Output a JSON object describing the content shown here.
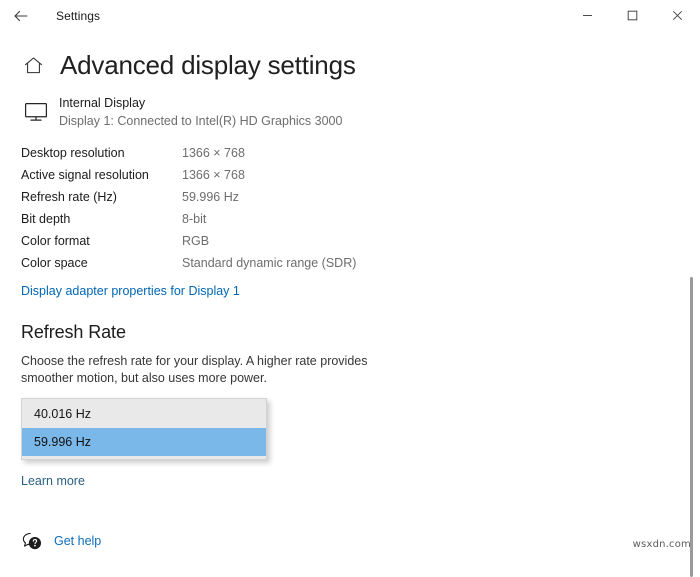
{
  "titlebar": {
    "back_icon": "back-arrow-icon",
    "title": "Settings",
    "minimize_icon": "minimize-icon",
    "maximize_icon": "maximize-icon",
    "close_icon": "close-icon"
  },
  "header": {
    "home_icon": "home-icon",
    "title": "Advanced display settings"
  },
  "display": {
    "monitor_icon": "monitor-icon",
    "name": "Internal Display",
    "subtitle": "Display 1: Connected to Intel(R) HD Graphics 3000"
  },
  "specs": [
    {
      "label": "Desktop resolution",
      "value": "1366 × 768"
    },
    {
      "label": "Active signal resolution",
      "value": "1366 × 768"
    },
    {
      "label": "Refresh rate (Hz)",
      "value": "59.996 Hz"
    },
    {
      "label": "Bit depth",
      "value": "8-bit"
    },
    {
      "label": "Color format",
      "value": "RGB"
    },
    {
      "label": "Color space",
      "value": "Standard dynamic range (SDR)"
    }
  ],
  "adapter_link": "Display adapter properties for Display 1",
  "refresh_rate": {
    "section_title": "Refresh Rate",
    "description": "Choose the refresh rate for your display. A higher rate provides smoother motion, but also uses more power.",
    "options": [
      {
        "label": "40.016 Hz",
        "selected": false
      },
      {
        "label": "59.996 Hz",
        "selected": true
      }
    ],
    "selected_value": "59.996 Hz"
  },
  "learn_more": "Learn more",
  "get_help": {
    "icon": "help-bubble-icon",
    "label": "Get help"
  },
  "watermark": "wsxdn.com",
  "colors": {
    "accent_link": "#0066b4",
    "secondary_link": "#2a5e85",
    "help_link": "#0f6cbd",
    "selection_blue": "#7ab8ea",
    "dropdown_bg": "#e9e9e9",
    "value_text": "#6d6d6d"
  }
}
